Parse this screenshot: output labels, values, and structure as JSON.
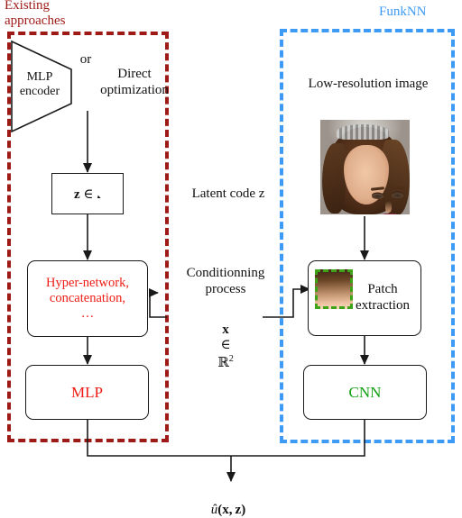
{
  "figure": {
    "title_left": "Existing\napproaches",
    "title_right": "FunkNN",
    "accent_left": "#9e1a17",
    "accent_right": "#3d9bf5",
    "accent_red_text": "#ee1c14",
    "accent_green_text": "#12a012",
    "accent_patch_border": "#3fa317"
  },
  "left_branch": {
    "encoder_label": "MLP\nencoder",
    "or_label": "or",
    "direct_label": "Direct\noptimization",
    "latent_box_label": "z ∈ 𝒵",
    "latent_box_label_plain": "z ∈ Z",
    "conditioning_box_label": "Hyper-network,\nconcatenation,\n…",
    "decoder_box_label": "MLP"
  },
  "right_branch": {
    "lowres_label": "Low-resolution image",
    "image_alt": "low-resolution face photo",
    "patch_box_label": "Patch\nextraction",
    "decoder_box_label": "CNN"
  },
  "middle_labels": {
    "latent_code": "Latent code z",
    "conditioning_process": "Conditionning\nprocess",
    "coordinate": "x ∈ ℝ²",
    "coordinate_plain": "x ∈ R^2"
  },
  "output": {
    "label": "û(x, z)",
    "label_plain": "u-hat(x, z)"
  }
}
